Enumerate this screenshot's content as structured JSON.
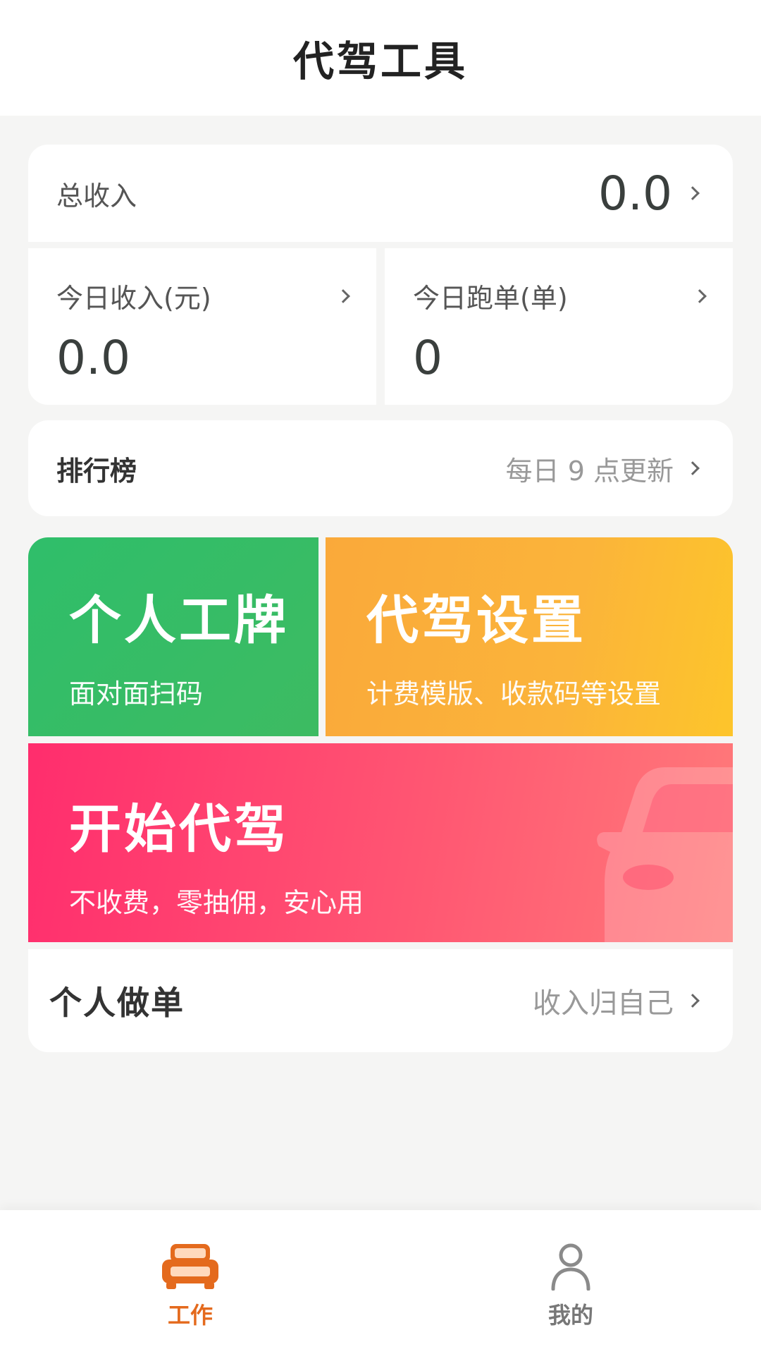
{
  "header": {
    "title": "代驾工具"
  },
  "income": {
    "total_label": "总收入",
    "total_value": "0.0",
    "today_income_label": "今日收入(元)",
    "today_income_value": "0.0",
    "today_orders_label": "今日跑单(单)",
    "today_orders_value": "0"
  },
  "ranking": {
    "label": "排行榜",
    "note": "每日 9 点更新"
  },
  "tiles": {
    "badge": {
      "title": "个人工牌",
      "subtitle": "面对面扫码"
    },
    "settings": {
      "title": "代驾设置",
      "subtitle": "计费模版、收款码等设置"
    },
    "start": {
      "title": "开始代驾",
      "subtitle": "不收费，零抽佣，安心用"
    }
  },
  "personal": {
    "label": "个人做单",
    "note": "收入归自己"
  },
  "tabbar": {
    "items": [
      {
        "label": "工作",
        "icon": "car-icon",
        "active": true
      },
      {
        "label": "我的",
        "icon": "person-icon",
        "active": false
      }
    ]
  },
  "colors": {
    "accent": "#e46a1d",
    "green_tile": "#2fbe6a",
    "orange_tile": "#fbb43a",
    "pink_tile": "#ff4a6e"
  }
}
